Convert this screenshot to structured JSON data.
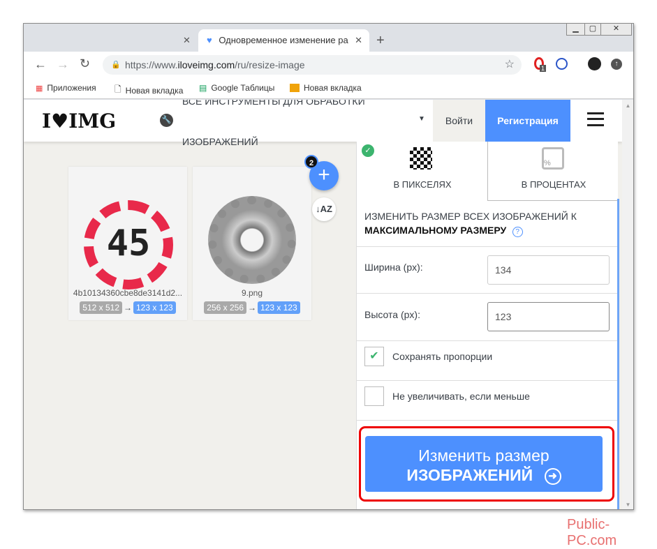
{
  "browser": {
    "tab_title": "Одновременное изменение ра",
    "url_prefix": "https://www.",
    "url_domain": "iloveimg.com",
    "url_path": "/ru/resize-image",
    "ext_badge": "1",
    "bookmarks": [
      "Приложения",
      "Новая вкладка",
      "Google Таблицы",
      "Новая вкладка"
    ]
  },
  "header": {
    "logo": "I♥IMG",
    "tools_line1": "ВСЕ ИНСТРУМЕНТЫ ДЛЯ ОБРАБОТКИ",
    "tools_line2": "ИЗОБРАЖЕНИЙ",
    "login": "Войти",
    "register": "Регистрация"
  },
  "files": {
    "count": "2",
    "items": [
      {
        "name": "4b10134360cbe8de3141d2...",
        "orig": "512 x 512",
        "new": "123 x 123",
        "preview": "45"
      },
      {
        "name": "9.png",
        "orig": "256 x 256",
        "new": "123 x 123"
      }
    ]
  },
  "panel": {
    "tab_pixels": "В ПИКСЕЛЯХ",
    "tab_percent": "В ПРОЦЕНТАХ",
    "desc_line": "ИЗМЕНИТЬ РАЗМЕР ВСЕХ ИЗОБРАЖЕНИЙ К",
    "desc_bold": "МАКСИМАЛЬНОМУ РАЗМЕРУ",
    "width_label": "Ширина (px):",
    "width_value": "134",
    "height_label": "Высота (px):",
    "height_value": "123",
    "keep_ratio": "Сохранять пропорции",
    "no_enlarge": "Не увеличивать, если меньше",
    "button_line1": "Изменить размер",
    "button_line2": "ИЗОБРАЖЕНИЙ"
  },
  "watermark": "Public-PC.com"
}
